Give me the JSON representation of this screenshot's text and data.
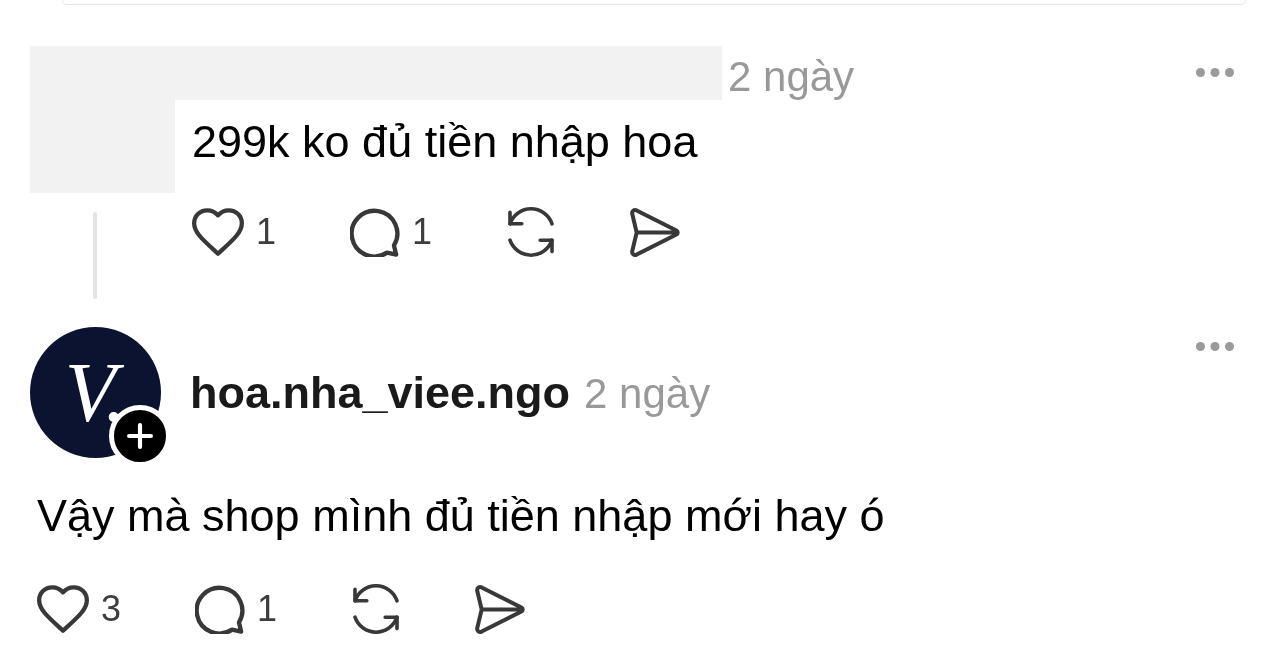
{
  "thread": [
    {
      "kind": "redacted",
      "time": "2 ngày",
      "text": "299k ko đủ tiền nhập hoa",
      "thread_line": true,
      "actions": [
        {
          "kind": "like",
          "count": "1"
        },
        {
          "kind": "reply",
          "count": "1"
        },
        {
          "kind": "repost"
        },
        {
          "kind": "share"
        }
      ]
    },
    {
      "kind": "profile",
      "avatar": {
        "logo_text": "V."
      },
      "follow_button": true,
      "username": "hoa.nha_viee.ngo",
      "time": "2 ngày",
      "text": "Vậy mà shop mình đủ tiền nhập mới hay ó",
      "actions": [
        {
          "kind": "like",
          "count": "3"
        },
        {
          "kind": "reply",
          "count": "1"
        },
        {
          "kind": "repost"
        },
        {
          "kind": "share"
        }
      ]
    }
  ]
}
